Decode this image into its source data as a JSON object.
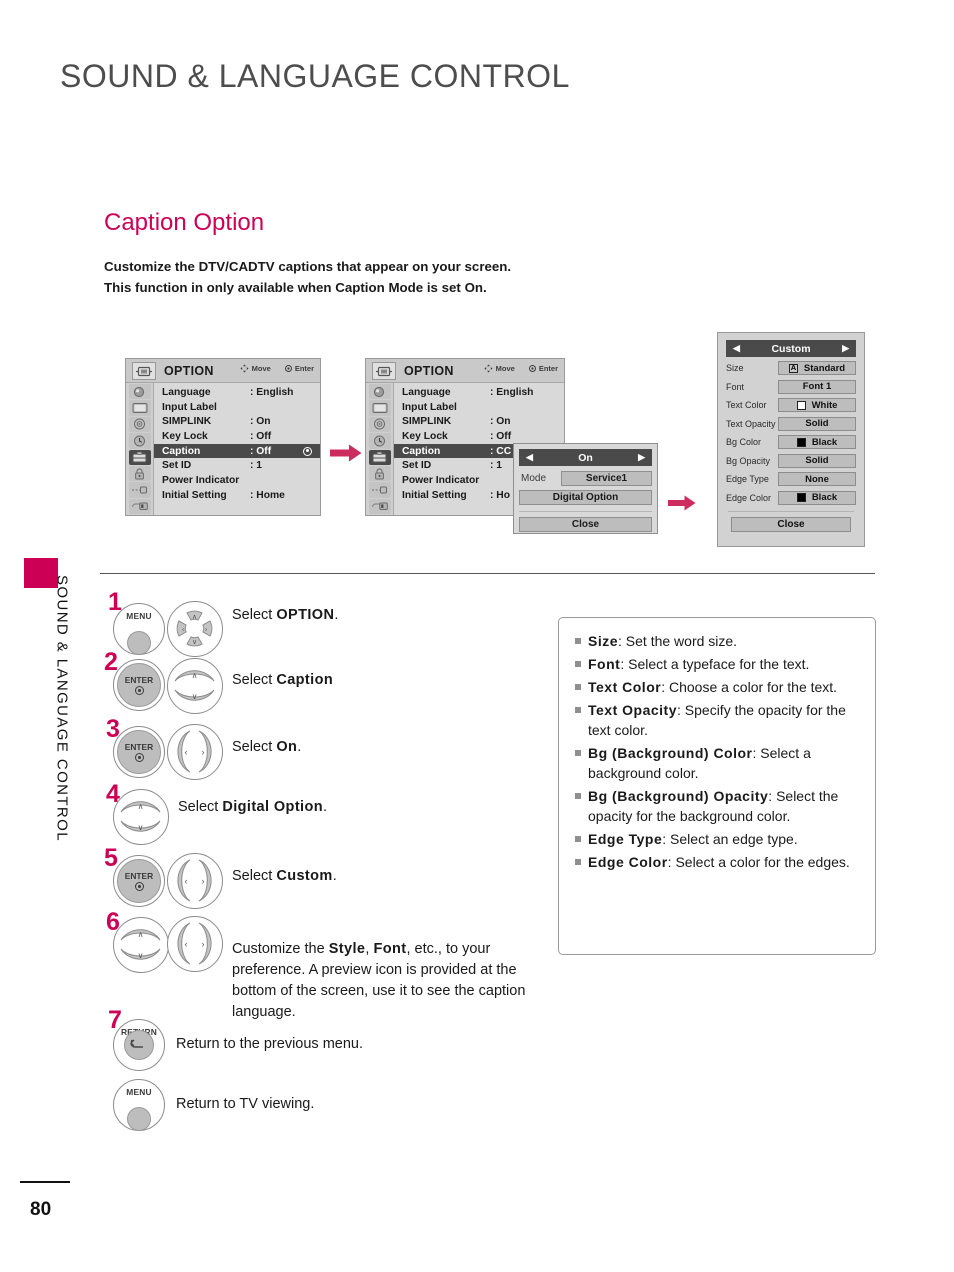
{
  "page": {
    "header_title": "SOUND & LANGUAGE CONTROL",
    "section_title": "Caption Option",
    "intro_line1": "Customize the DTV/CADTV captions that appear on your screen.",
    "intro_line2_a": "This function in only available when ",
    "intro_line2_b": "Caption",
    "intro_line2_c": " Mode is set ",
    "intro_line2_d": "On",
    "intro_line2_e": ".",
    "side_tab_label": "SOUND & LANGUAGE CONTROL",
    "page_number": "80",
    "accent_color": "#cc0055"
  },
  "osd_menu_1": {
    "title": "OPTION",
    "hint_move": "Move",
    "hint_enter": "Enter",
    "rows": [
      {
        "label": "Language",
        "value": ": English",
        "highlight": false
      },
      {
        "label": "Input Label",
        "value": "",
        "highlight": false
      },
      {
        "label": "SIMPLINK",
        "value": ": On",
        "highlight": false
      },
      {
        "label": "Key Lock",
        "value": ": Off",
        "highlight": false
      },
      {
        "label": "Caption",
        "value": ": Off",
        "highlight": true
      },
      {
        "label": "Set ID",
        "value": ": 1",
        "highlight": false
      },
      {
        "label": "Power Indicator",
        "value": "",
        "highlight": false
      },
      {
        "label": "Initial Setting",
        "value": ": Home",
        "highlight": false
      }
    ]
  },
  "osd_menu_2": {
    "title": "OPTION",
    "hint_move": "Move",
    "hint_enter": "Enter",
    "rows": [
      {
        "label": "Language",
        "value": ": English",
        "highlight": false
      },
      {
        "label": "Input Label",
        "value": "",
        "highlight": false
      },
      {
        "label": "SIMPLINK",
        "value": ": On",
        "highlight": false
      },
      {
        "label": "Key Lock",
        "value": ": Off",
        "highlight": false
      },
      {
        "label": "Caption",
        "value": ": CC",
        "highlight": true
      },
      {
        "label": "Set ID",
        "value": ": 1",
        "highlight": false
      },
      {
        "label": "Power Indicator",
        "value": "",
        "highlight": false
      },
      {
        "label": "Initial Setting",
        "value": ": Ho",
        "highlight": false
      }
    ]
  },
  "caption_popup": {
    "header": "On",
    "arrow_left": "◀",
    "arrow_right": "▶",
    "mode_label": "Mode",
    "mode_value": "Service1",
    "digital_option": "Digital Option",
    "close": "Close"
  },
  "custom_panel": {
    "header": "Custom",
    "arrow_left": "◀",
    "arrow_right": "▶",
    "rows": [
      {
        "label": "Size",
        "value": "Standard",
        "swatch": "letter",
        "swatch_text": "A"
      },
      {
        "label": "Font",
        "value": "Font 1",
        "swatch": "none",
        "swatch_text": ""
      },
      {
        "label": "Text Color",
        "value": "White",
        "swatch": "white",
        "swatch_text": ""
      },
      {
        "label": "Text Opacity",
        "value": "Solid",
        "swatch": "none",
        "swatch_text": ""
      },
      {
        "label": "Bg Color",
        "value": "Black",
        "swatch": "black",
        "swatch_text": ""
      },
      {
        "label": "Bg Opacity",
        "value": "Solid",
        "swatch": "none",
        "swatch_text": ""
      },
      {
        "label": "Edge Type",
        "value": "None",
        "swatch": "none",
        "swatch_text": ""
      },
      {
        "label": "Edge Color",
        "value": "Black",
        "swatch": "black",
        "swatch_text": ""
      }
    ],
    "close": "Close"
  },
  "steps": [
    {
      "num": "1",
      "buttons": [
        "MENU",
        "dpad4"
      ],
      "text_pre": "Select ",
      "text_bold": "OPTION",
      "text_post": "."
    },
    {
      "num": "2",
      "buttons": [
        "ENTER",
        "updown"
      ],
      "text_pre": "Select ",
      "text_bold": "Caption",
      "text_post": ""
    },
    {
      "num": "3",
      "buttons": [
        "ENTER",
        "leftright"
      ],
      "text_pre": "Select ",
      "text_bold": "On",
      "text_post": "."
    },
    {
      "num": "4",
      "buttons": [
        "updown"
      ],
      "text_pre": "Select ",
      "text_bold": "Digital Option",
      "text_post": "."
    },
    {
      "num": "5",
      "buttons": [
        "ENTER",
        "leftright"
      ],
      "text_pre": "Select ",
      "text_bold": "Custom",
      "text_post": "."
    },
    {
      "num": "6",
      "buttons": [
        "updown",
        "leftright"
      ],
      "text_pre": "Customize the ",
      "text_bold": "Style",
      "text_post": ", "
    },
    {
      "num": "7",
      "buttons": [
        "RETURN"
      ],
      "text_pre": "Return to the previous menu.",
      "text_bold": "",
      "text_post": ""
    }
  ],
  "step6": {
    "part1": "Customize the ",
    "bold1": "Style",
    "part2": ", ",
    "bold2": "Font",
    "part3": ", etc., to your preference. A preview icon is provided at the bottom of the screen, use it to see the caption language."
  },
  "step7_text": "Return to the previous menu.",
  "step8": {
    "button": "MENU",
    "text": "Return to TV viewing."
  },
  "button_labels": {
    "menu": "MENU",
    "enter": "ENTER",
    "return": "RETURN"
  },
  "info_box": {
    "items": [
      {
        "term": "Size",
        "desc": ": Set the word size."
      },
      {
        "term": "Font",
        "desc": ": Select a typeface for the text."
      },
      {
        "term": "Text Color",
        "desc": ": Choose a color for the text."
      },
      {
        "term": "Text Opacity",
        "desc": ": Specify the opacity for the text color."
      },
      {
        "term": "Bg (Background) Color",
        "desc": ": Select a background color."
      },
      {
        "term": "Bg (Background) Opacity",
        "desc": ": Select the opacity for the background color."
      },
      {
        "term": "Edge Type",
        "desc": ": Select an edge type."
      },
      {
        "term": "Edge Color",
        "desc": ": Select a color for the edges."
      }
    ]
  }
}
